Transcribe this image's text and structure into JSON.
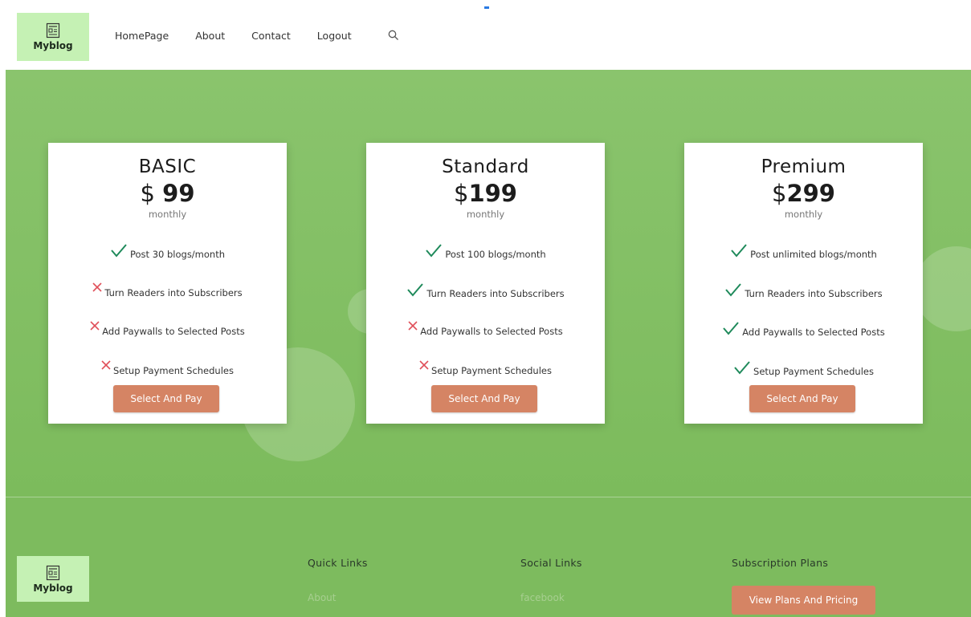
{
  "header": {
    "logo_text": "Myblog",
    "nav": [
      "HomePage",
      "About",
      "Contact",
      "Logout"
    ]
  },
  "plans": [
    {
      "name": "BASIC",
      "currency": "$",
      "price": "99",
      "period": "monthly",
      "features": [
        {
          "text": "Post 30 blogs/month",
          "included": true
        },
        {
          "text": "Turn Readers into Subscribers",
          "included": false
        },
        {
          "text": "Add Paywalls to Selected Posts",
          "included": false
        },
        {
          "text": "Setup Payment Schedules",
          "included": false
        }
      ],
      "button": "Select And Pay"
    },
    {
      "name": "Standard",
      "currency": "$",
      "price": "199",
      "period": "monthly",
      "features": [
        {
          "text": "Post 100 blogs/month",
          "included": true
        },
        {
          "text": "Turn Readers into Subscribers",
          "included": true
        },
        {
          "text": "Add Paywalls to Selected Posts",
          "included": false
        },
        {
          "text": "Setup Payment Schedules",
          "included": false
        }
      ],
      "button": "Select And Pay"
    },
    {
      "name": "Premium",
      "currency": "$",
      "price": "299",
      "period": "monthly",
      "features": [
        {
          "text": "Post unlimited blogs/month",
          "included": true
        },
        {
          "text": "Turn Readers into Subscribers",
          "included": true
        },
        {
          "text": "Add Paywalls to Selected Posts",
          "included": true
        },
        {
          "text": "Setup Payment Schedules",
          "included": true
        }
      ],
      "button": "Select And Pay"
    }
  ],
  "footer": {
    "logo_text": "Myblog",
    "quick_links_title": "Quick Links",
    "quick_links": [
      "About"
    ],
    "social_links_title": "Social Links",
    "social_links": [
      "facebook"
    ],
    "subscription_title": "Subscription Plans",
    "subscription_button": "View Plans And Pricing"
  },
  "colors": {
    "check": "#1f8a5b",
    "cross": "#e0505a",
    "button": "#d58464",
    "hero": "#7cbb5c",
    "logo_bg": "#c5f1b4"
  },
  "icons": {
    "logo": "newspaper-icon",
    "search": "search-icon",
    "included": "check-icon",
    "excluded": "cross-icon"
  }
}
